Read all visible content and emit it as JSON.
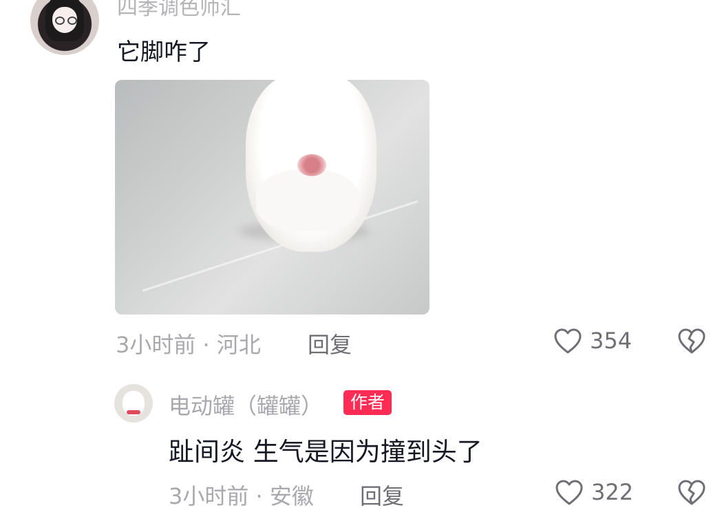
{
  "comment": {
    "username": "四季调色师汇",
    "text": "它脚咋了",
    "time_location": "3小时前 · 河北",
    "reply_label": "回复",
    "like_count": "354",
    "avatar_icon": "avatar-girl-glasses",
    "image_icon": "dog-paw-photo"
  },
  "reply": {
    "username": "电动罐（罐罐）",
    "badge": "作者",
    "text": "趾间炎 生气是因为撞到头了",
    "time_location": "3小时前 · 安徽",
    "reply_label": "回复",
    "like_count": "322",
    "avatar_icon": "avatar-white-dog"
  },
  "icons": {
    "like": "heart-outline-icon",
    "dislike": "broken-heart-icon"
  },
  "colors": {
    "badge_bg": "#fe2c55",
    "text_primary": "#161823",
    "text_secondary": "#a8a8ae",
    "icon_gray": "#6e6e74"
  }
}
